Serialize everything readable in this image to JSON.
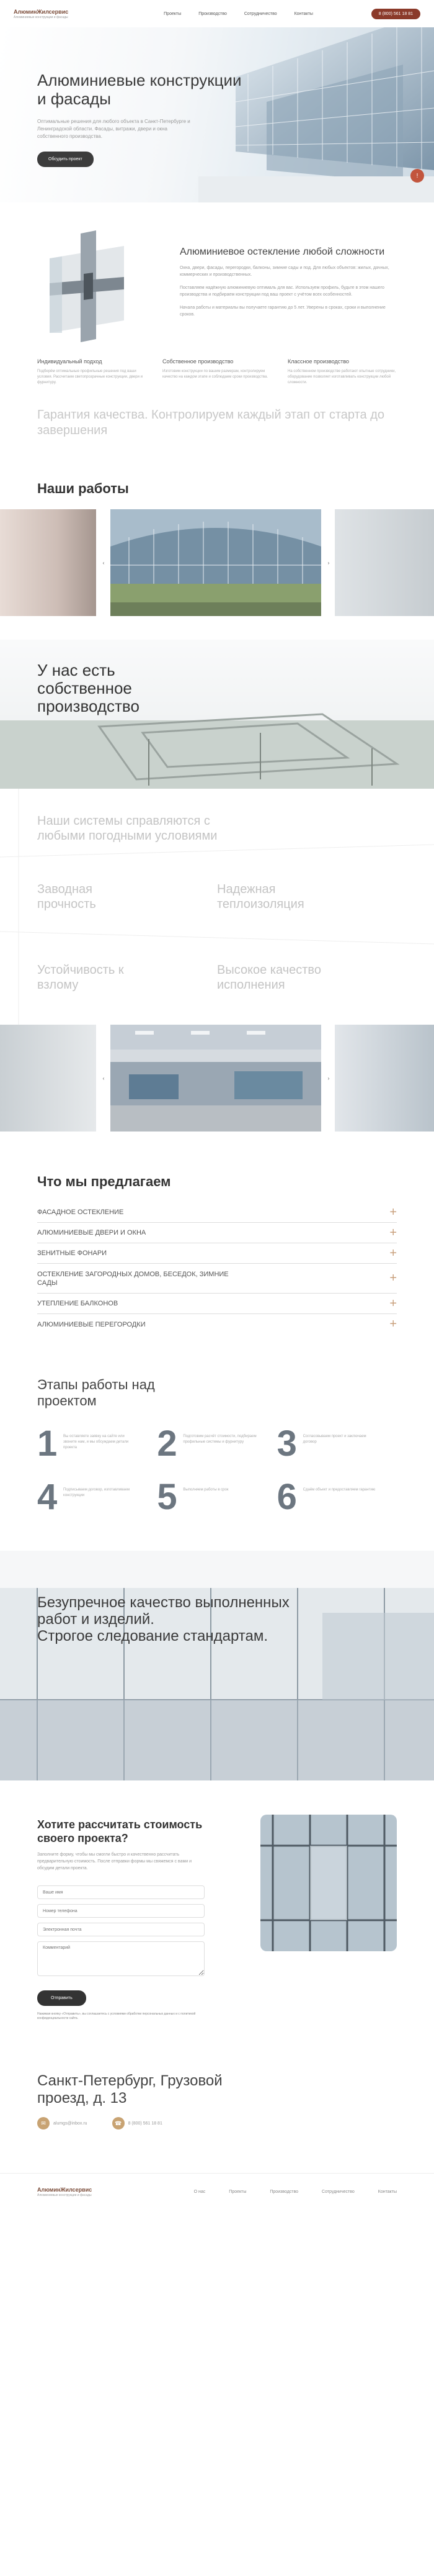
{
  "header": {
    "logo_title": "АлюминЖилсервис",
    "logo_sub": "Алюминиевые конструкции и фасады",
    "nav": [
      "Проекты",
      "Производство",
      "Сотрудничество",
      "Контакты"
    ],
    "phone": "8 (800) 561 18 81"
  },
  "hero": {
    "title": "Алюминиевые конструкции и фасады",
    "desc": "Оптимальные решения для любого объекта в Санкт-Петербурге и Ленинградской области. Фасады, витражи, двери и окна собственного производства.",
    "button": "Обсудить проект",
    "badge": "!"
  },
  "glazing": {
    "title": "Алюминиевое остекление любой сложности",
    "p1": "Окна, двери, фасады, перегородки, балконы, зимние сады и под. Для любых объектов: жилых, дачных, коммерческих и производственных.",
    "p2": "Поставляем надёжную алюминиевую оптималь для вас. Используем профиль, будьте в этом нашего производства и подбираем конструкции под ваш проект с учётом всех особенностей.",
    "p3": "Начала работы и материалы вы получаете гарантию до 5 лет. Уверены в сроках, сроки и выполнение сроков."
  },
  "features": [
    {
      "title": "Индивидуальный подход",
      "text": "Подберём оптимальные профильные решения под ваши условия. Рассчитаем светопрозрачные конструкции, двери и фурнитуру."
    },
    {
      "title": "Собственное производство",
      "text": "Изготовим конструкции по вашим размерам, контролируем качество на каждом этапе и соблюдаем сроки производства."
    },
    {
      "title": "Классное производство",
      "text": "На собственном производстве работают опытные сотрудники, оборудование позволяет изготавливать конструкции любой сложности."
    }
  ],
  "quality_line": "Гарантия качества. Контролируем каждый этап от старта до завершения",
  "works_title": "Наши работы",
  "gallery_arrows": {
    "prev": "‹",
    "next": "›"
  },
  "production": {
    "title": "У нас есть собственное производство",
    "props": [
      "Наши системы справляются с любыми погодными условиями",
      "Заводная прочность",
      "Надежная теплоизоляция",
      "Устойчивость к взлому",
      "Высокое качество исполнения"
    ]
  },
  "offers": {
    "title": "Что мы предлагаем",
    "items": [
      "Фасадное остекление",
      "Алюминиевые двери и окна",
      "Зенитные фонари",
      "Остекление загородных домов, беседок, зимние сады",
      "Утепление балконов",
      "Алюминиевые перегородки"
    ],
    "plus": "+"
  },
  "stages": {
    "title": "Этапы работы над проектом",
    "items": [
      {
        "num": "1",
        "text": "Вы оставляете заявку на сайте или звоните нам, и мы обсуждаем детали проекта"
      },
      {
        "num": "2",
        "text": "Подготовим расчёт стоимости, подбираем профильные системы и фурнитуру"
      },
      {
        "num": "3",
        "text": "Согласовываем проект и заключаем договор"
      },
      {
        "num": "4",
        "text": "Подписываем договор, изготавливаем конструкции"
      },
      {
        "num": "5",
        "text": "Выполняем работы в срок"
      },
      {
        "num": "6",
        "text": "Сдаём объект и предоставляем гарантию"
      }
    ]
  },
  "banner": {
    "line1": "Безупречное качество выполненных работ и изделий.",
    "line2": "Строгое следование стандартам."
  },
  "calc": {
    "title": "Хотите рассчитать стоимость своего проекта?",
    "desc": "Заполните форму, чтобы мы смогли быстро и качественно рассчитать предварительную стоимость. После отправки формы мы свяжемся с вами и обсудим детали проекта.",
    "fields": [
      "Ваше имя",
      "Номер телефона",
      "Электронная почта",
      "Комментарий"
    ],
    "button": "Отправить",
    "consent": "Нажимая кнопку «Отправить», вы соглашаетесь с условиями обработки персональных данных и с политикой конфиденциальности сайта."
  },
  "contacts": {
    "address": "Санкт-Петербург, Грузовой проезд, д. 13",
    "email": "alumgs@inbox.ru",
    "phone": "8 (800) 561 18 81"
  },
  "footer": {
    "logo_title": "АлюминЖилсервис",
    "logo_sub": "Алюминиевые конструкции и фасады",
    "nav": [
      "О нас",
      "Проекты",
      "Производство",
      "Сотрудничество",
      "Контакты"
    ]
  }
}
